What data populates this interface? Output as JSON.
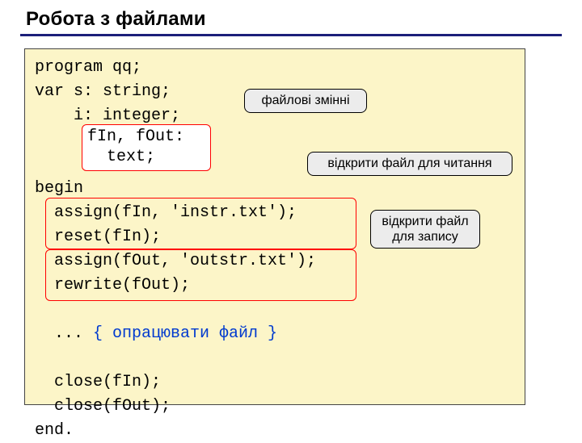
{
  "heading": "Робота з файлами",
  "code": {
    "l1": "program qq;",
    "l2": "var s: string;",
    "l3": "    i: integer;",
    "l4": "begin",
    "l5": "  assign(fIn, 'instr.txt');",
    "l6": "  reset(fIn);",
    "l7": "  assign(fOut, 'outstr.txt');",
    "l8": "  rewrite(fOut);",
    "l9_pre": "  ... ",
    "l9_comment": "{ опрацювати файл }",
    "l10": "  close(fIn);",
    "l11": "  close(fOut);",
    "l12": "end."
  },
  "inline_decl": {
    "line1": "fIn, fOut:",
    "line2": "  text;"
  },
  "callouts": {
    "c1": "файлові змінні",
    "c2": "відкрити файл для читання",
    "c3_line1": "відкрити файл",
    "c3_line2": "для запису"
  }
}
